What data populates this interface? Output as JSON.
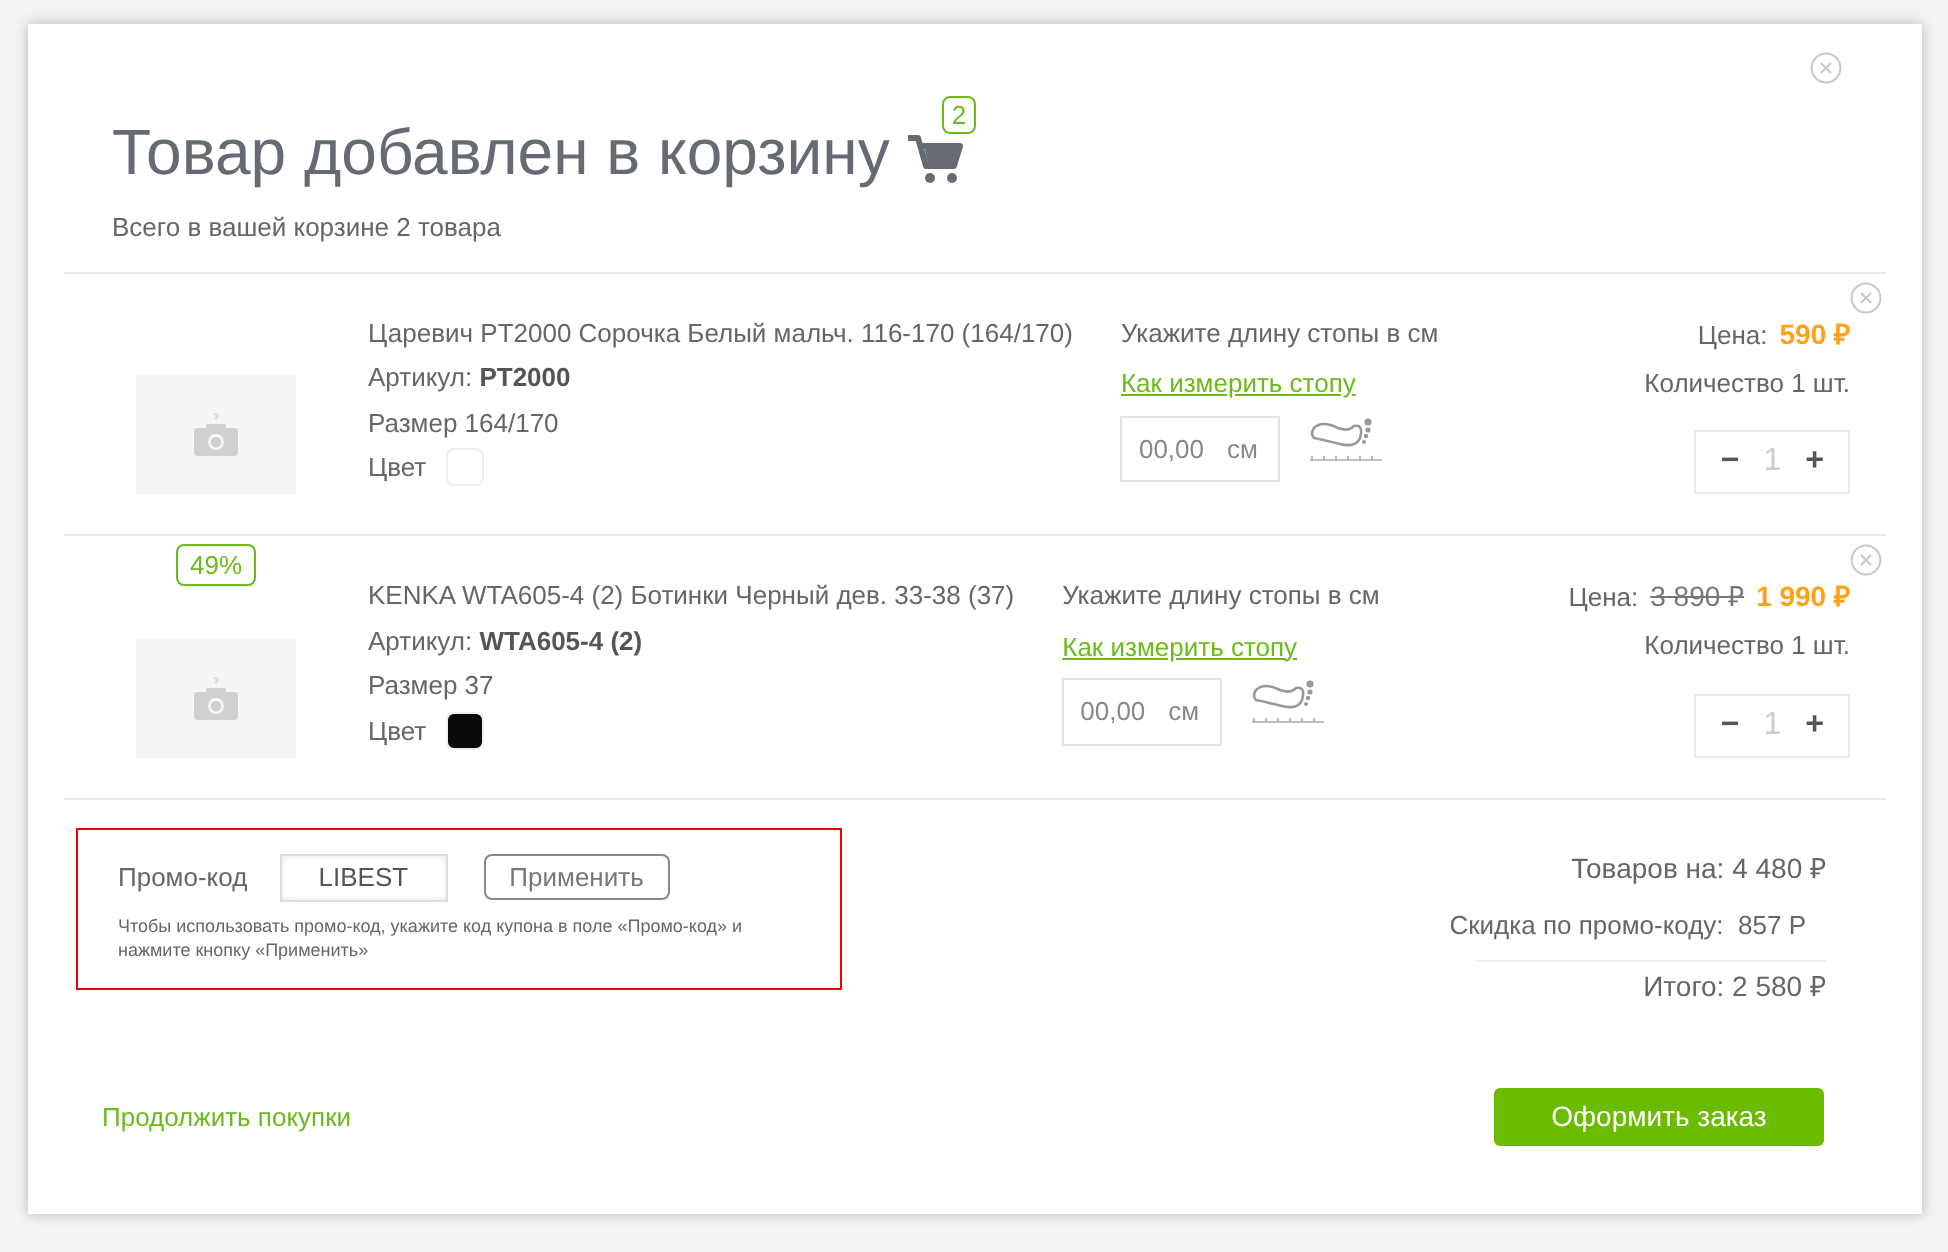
{
  "title": "Товар добавлен в корзину",
  "cart_count": "2",
  "subtitle": "Всего в вашей корзине 2 товара",
  "items": [
    {
      "name": "Царевич PT2000 Сорочка Белый мальч. 116-170 (164/170)",
      "article_label": "Артикул:",
      "article": "PT2000",
      "size": "Размер 164/170",
      "color_label": "Цвет",
      "color": "#ffffff",
      "foot_prompt": "Укажите длину стопы в см",
      "foot_link": "Как измерить стопу",
      "foot_placeholder": "00,00",
      "foot_unit": "см",
      "price_label": "Цена:",
      "price": "590 ₽",
      "quantity": "Количество 1 шт.",
      "qty": "1",
      "minus": "−",
      "plus": "+"
    },
    {
      "badge": "49%",
      "name": "KENKA WTA605-4 (2) Ботинки Черный дев. 33-38 (37)",
      "article_label": "Артикул:",
      "article": "WTA605-4 (2)",
      "size": "Размер 37",
      "color_label": "Цвет",
      "color": "#0a0a0a",
      "foot_prompt": "Укажите длину стопы в см",
      "foot_link": "Как измерить стопу",
      "foot_placeholder": "00,00",
      "foot_unit": "см",
      "price_label": "Цена:",
      "old_price": "3 890 ₽",
      "price": "1 990 ₽",
      "quantity": "Количество 1 шт.",
      "qty": "1",
      "minus": "−",
      "plus": "+"
    }
  ],
  "promo": {
    "label": "Промо-код",
    "value": "LIBEST",
    "apply": "Применить",
    "hint": "Чтобы использовать промо-код, укажите код купона в поле «Промо-код» и нажмите кнопку «Применить»"
  },
  "totals": {
    "goods": "Товаров на: 4 480 ₽",
    "discount": "Скидка по промо-коду:  857 Р",
    "total": "Итого: 2 580 ₽"
  },
  "continue": "Продолжить покупки",
  "checkout": "Оформить заказ"
}
